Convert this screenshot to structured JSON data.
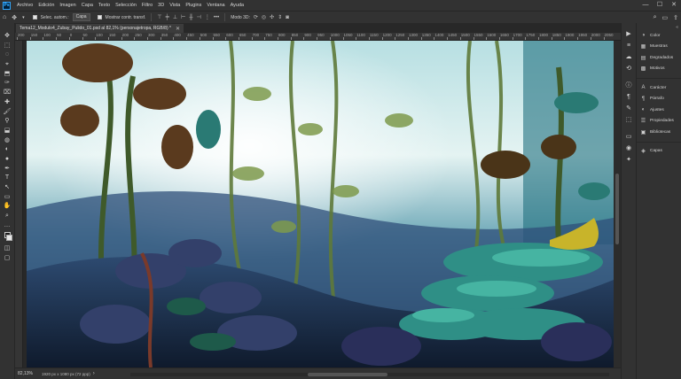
{
  "app": {
    "logo_text": "Ps"
  },
  "menu": {
    "items": [
      "Archivo",
      "Edición",
      "Imagen",
      "Capa",
      "Texto",
      "Selección",
      "Filtro",
      "3D",
      "Vista",
      "Plugins",
      "Ventana",
      "Ayuda"
    ]
  },
  "window": {
    "minimize": "—",
    "maximize": "☐",
    "close": "✕"
  },
  "options": {
    "autoselect_label": "Selec. autom.:",
    "autoselect_value": "Capa",
    "transform_label": "Mostrar contr. transf.",
    "mode_3d_label": "Modo 3D:"
  },
  "document": {
    "tab_title": "Tema12_Modulo4_Zubay_Pulido_01.psd al 82,1% (personajetropa, RGB/8) *",
    "close": "✕"
  },
  "ruler": {
    "h_labels": [
      "200",
      "150",
      "100",
      "50",
      "0",
      "50",
      "100",
      "150",
      "200",
      "250",
      "300",
      "350",
      "400",
      "450",
      "500",
      "550",
      "600",
      "650",
      "700",
      "750",
      "800",
      "850",
      "900",
      "950",
      "1000",
      "1050",
      "1100",
      "1150",
      "1200",
      "1250",
      "1300",
      "1350",
      "1400",
      "1450",
      "1500",
      "1550",
      "1600",
      "1650",
      "1700",
      "1750",
      "1800",
      "1850",
      "1900",
      "1950",
      "2000",
      "2050",
      "2100"
    ]
  },
  "status": {
    "zoom": "82,13%",
    "info": "1920 px x 1080 px (72 ppp)",
    "chevron": "›"
  },
  "panels": {
    "collapse": "«",
    "group1": [
      {
        "label": "Color",
        "icon": "color-wheel-icon",
        "glyph": "◑"
      },
      {
        "label": "Muestras",
        "icon": "swatches-icon",
        "glyph": "▦"
      },
      {
        "label": "Degradados",
        "icon": "gradients-icon",
        "glyph": "▤"
      },
      {
        "label": "Motivos",
        "icon": "patterns-icon",
        "glyph": "▩"
      }
    ],
    "group2": [
      {
        "label": "Carácter",
        "icon": "character-icon",
        "glyph": "A"
      },
      {
        "label": "Párrafo",
        "icon": "paragraph-icon",
        "glyph": "¶"
      },
      {
        "label": "Ajustes",
        "icon": "adjustments-icon",
        "glyph": "◐"
      },
      {
        "label": "Propiedades",
        "icon": "properties-icon",
        "glyph": "☰"
      },
      {
        "label": "Bibliotecas",
        "icon": "libraries-icon",
        "glyph": "▣"
      }
    ],
    "group3": [
      {
        "label": "Capas",
        "icon": "layers-icon",
        "glyph": "◈"
      }
    ]
  },
  "strip_icons": [
    "▶",
    "≡",
    "☁",
    "⟲",
    "ⓘ",
    "¶",
    "✎",
    "⬚",
    "▭",
    "◉",
    "✦"
  ],
  "tools": [
    "✥",
    "⬚",
    "◌",
    "⌖",
    "⬒",
    "✑",
    "⌧",
    "✚",
    "🖌",
    "⚲",
    "⬓",
    "◍",
    "◐",
    "●",
    "✒",
    "T",
    "↖",
    "▭",
    "✋",
    "⌕",
    "…"
  ]
}
